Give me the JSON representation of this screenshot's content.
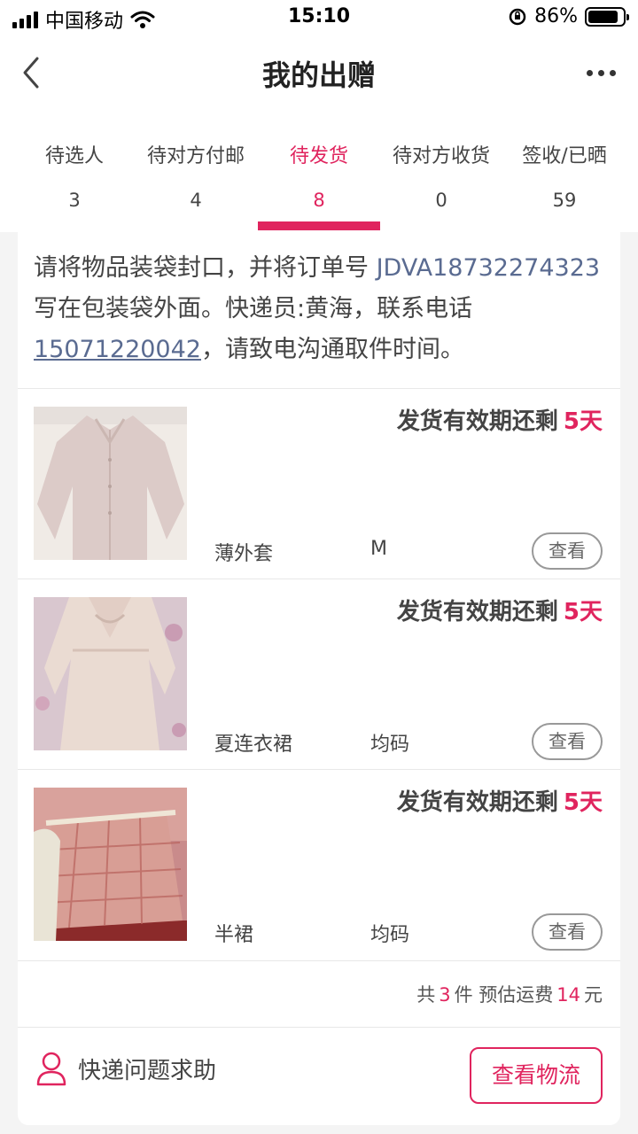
{
  "status_bar": {
    "carrier": "中国移动",
    "time": "15:10",
    "battery_percent": "86%",
    "icons": [
      "signal-icon",
      "wifi-icon",
      "orientation-lock-icon",
      "battery-icon"
    ]
  },
  "nav": {
    "title": "我的出赠",
    "icons": [
      "back-arrow-icon",
      "more-icon"
    ]
  },
  "tabs": [
    {
      "label": "待选人",
      "count": "3",
      "active": false
    },
    {
      "label": "待对方付邮",
      "count": "4",
      "active": false
    },
    {
      "label": "待发货",
      "count": "8",
      "active": true
    },
    {
      "label": "待对方收货",
      "count": "0",
      "active": false
    },
    {
      "label": "签收/已晒",
      "count": "59",
      "active": false
    }
  ],
  "notice": {
    "part1": "请将物品装袋封口，并将订单号 ",
    "order_no": "JDVA18732274323",
    "part2": " 写在包装袋外面。快递员:黄海，联系电话",
    "phone": "15071220042",
    "part3": "，请致电沟通取件时间。"
  },
  "items": [
    {
      "deadline_label": "发货有效期还剩",
      "deadline_days": "5天",
      "name": "薄外套",
      "size": "M",
      "view_label": "查看"
    },
    {
      "deadline_label": "发货有效期还剩",
      "deadline_days": "5天",
      "name": "夏连衣裙",
      "size": "均码",
      "view_label": "查看"
    },
    {
      "deadline_label": "发货有效期还剩",
      "deadline_days": "5天",
      "name": "半裙",
      "size": "均码",
      "view_label": "查看"
    }
  ],
  "summary": {
    "prefix": "共",
    "count": "3",
    "middle": "件 预估运费",
    "fee": "14",
    "suffix": "元"
  },
  "footer": {
    "help_label": "快递问题求助",
    "logistics_label": "查看物流",
    "icons": [
      "user-icon"
    ]
  },
  "colors": {
    "accent": "#e0245e",
    "link": "#5a6b91"
  }
}
